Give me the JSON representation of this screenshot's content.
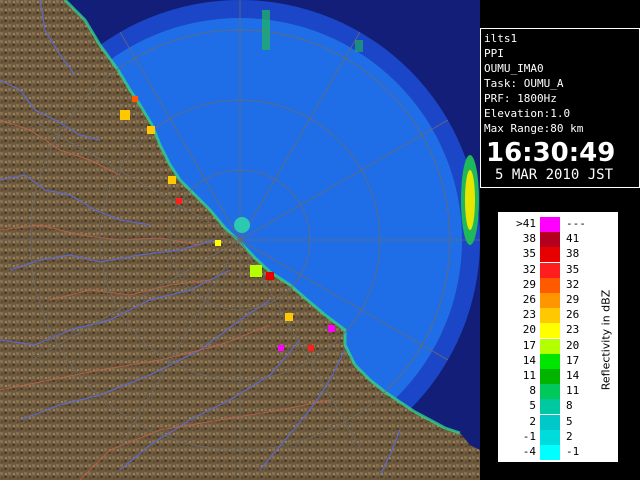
{
  "radar": {
    "site": "ilts1",
    "scan_type": "PPI",
    "product": "OUMU_IMA0",
    "task": "Task: OUMU_A",
    "prf": "PRF: 1800Hz",
    "elevation": "Elevation:1.0",
    "max_range": "Max Range:80 km",
    "time": "16:30:49",
    "date": "5 MAR 2010 JST",
    "colors": {
      "sea": "#1f6ee8",
      "range_ring_outer": "#1c46c8",
      "land": "#6e5a3e",
      "grid": "#6a6a6a",
      "coast_echo": "#2ed98c"
    }
  },
  "legend": {
    "title": "Reflectivity in dBZ",
    "levels": [
      {
        "low": ">41",
        "high": "---",
        "color": "#ff00ff"
      },
      {
        "low": "38",
        "high": "41",
        "color": "#b4001e"
      },
      {
        "low": "35",
        "high": "38",
        "color": "#e60000"
      },
      {
        "low": "32",
        "high": "35",
        "color": "#ff1e1e"
      },
      {
        "low": "29",
        "high": "32",
        "color": "#ff5a00"
      },
      {
        "low": "26",
        "high": "29",
        "color": "#ff9600"
      },
      {
        "low": "23",
        "high": "26",
        "color": "#ffc800"
      },
      {
        "low": "20",
        "high": "23",
        "color": "#ffff00"
      },
      {
        "low": "17",
        "high": "20",
        "color": "#b4ff00"
      },
      {
        "low": "14",
        "high": "17",
        "color": "#00e600"
      },
      {
        "low": "11",
        "high": "14",
        "color": "#00b400"
      },
      {
        "low": "8",
        "high": "11",
        "color": "#00c85a"
      },
      {
        "low": "5",
        "high": "8",
        "color": "#00c8a0"
      },
      {
        "low": "2",
        "high": "5",
        "color": "#00c8c8"
      },
      {
        "low": "-1",
        "high": "2",
        "color": "#00dcdc"
      },
      {
        "low": "-4",
        "high": "-1",
        "color": "#00ffff"
      }
    ]
  }
}
